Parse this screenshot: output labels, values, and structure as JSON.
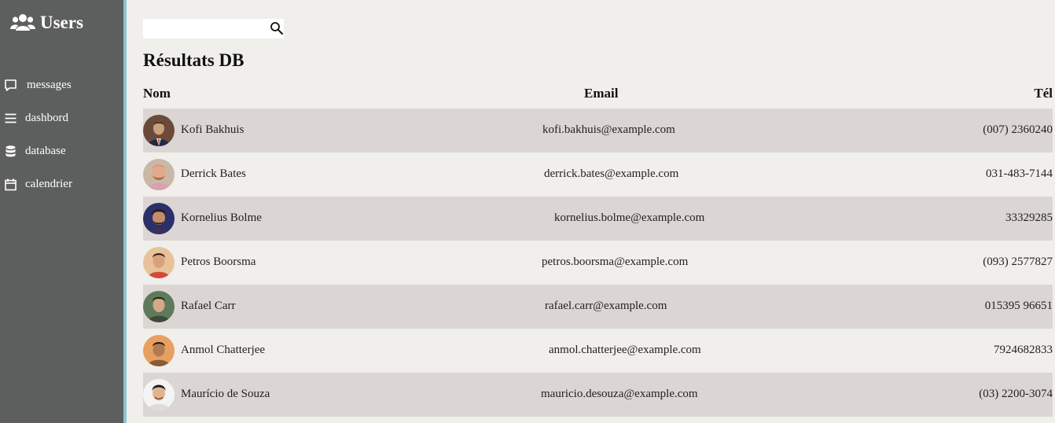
{
  "sidebar": {
    "title": "Users",
    "title_icon": "users-icon",
    "items": [
      {
        "label": "messages",
        "icon": "message-icon"
      },
      {
        "label": "dashbord",
        "icon": "menu-icon"
      },
      {
        "label": "database",
        "icon": "database-icon"
      },
      {
        "label": "calendrier",
        "icon": "calendar-icon"
      }
    ]
  },
  "search": {
    "value": "",
    "placeholder": "",
    "icon": "search-icon"
  },
  "main": {
    "title": "Résultats DB",
    "columns": {
      "name": "Nom",
      "email": "Email",
      "tel": "Tél"
    },
    "rows": [
      {
        "name": "Kofi Bakhuis",
        "email": "kofi.bakhuis@example.com",
        "tel": "(007) 2360240"
      },
      {
        "name": "Derrick Bates",
        "email": "derrick.bates@example.com",
        "tel": "031-483-7144"
      },
      {
        "name": "Kornelius Bolme",
        "email": "kornelius.bolme@example.com",
        "tel": "33329285"
      },
      {
        "name": "Petros Boorsma",
        "email": "petros.boorsma@example.com",
        "tel": "(093) 2577827"
      },
      {
        "name": "Rafael Carr",
        "email": "rafael.carr@example.com",
        "tel": "015395 96651"
      },
      {
        "name": "Anmol Chatterjee",
        "email": "anmol.chatterjee@example.com",
        "tel": "7924682833"
      },
      {
        "name": "Maurício de Souza",
        "email": "mauricio.desouza@example.com",
        "tel": "(03) 2200-3074"
      }
    ]
  },
  "colors": {
    "sidebar_bg": "#5d5e5e",
    "sidebar_border": "#8dc6cf",
    "page_bg": "#f0efec",
    "row_shaded": "#dbd6d3"
  }
}
